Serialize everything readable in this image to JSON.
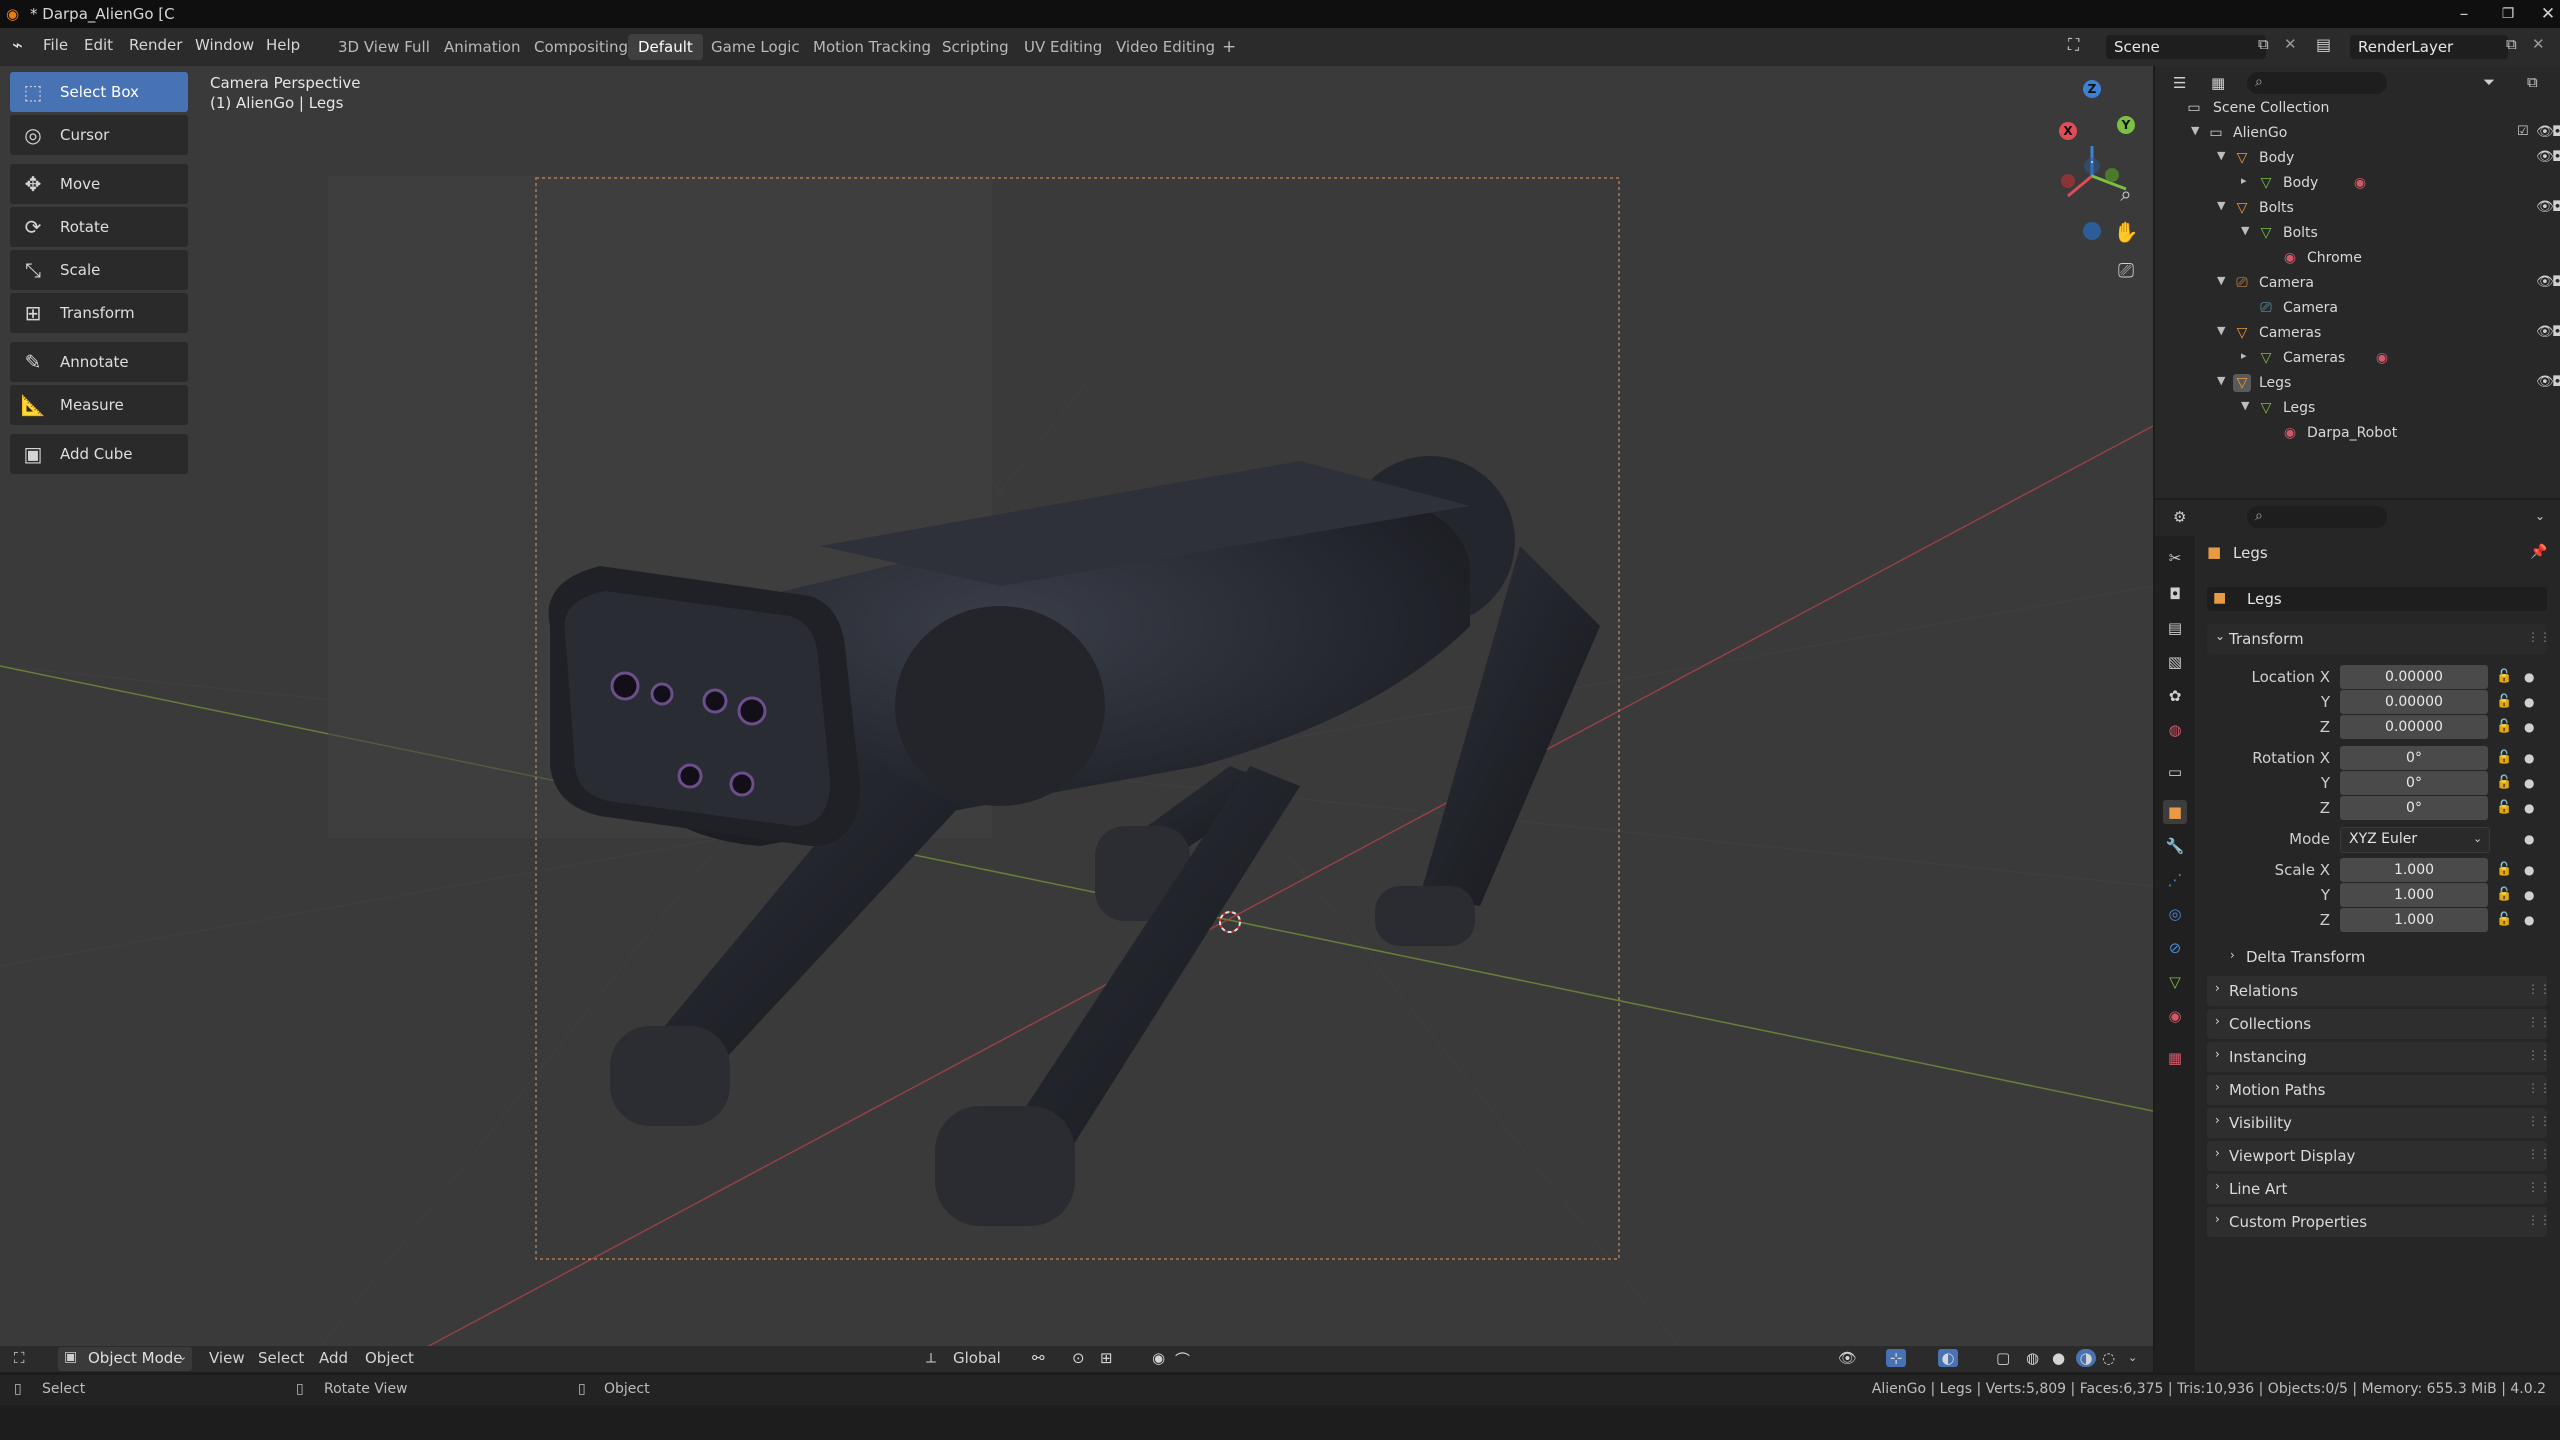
{
  "window": {
    "title": "* Darpa_AlienGo [C",
    "minimize": "–",
    "maximize": "❐",
    "close": "✕"
  },
  "menubar": {
    "menus": [
      "File",
      "Edit",
      "Render",
      "Window",
      "Help"
    ],
    "workspaces": [
      "3D View Full",
      "Animation",
      "Compositing",
      "Default",
      "Game Logic",
      "Motion Tracking",
      "Scripting",
      "UV Editing",
      "Video Editing"
    ],
    "active_workspace": "Default",
    "add_workspace": "+",
    "scene": "Scene",
    "render_layer": "RenderLayer"
  },
  "viewport": {
    "perspective": "Camera Perspective",
    "object_info": "(1) AlienGo | Legs",
    "tools": [
      "Select Box",
      "Cursor",
      "Move",
      "Rotate",
      "Scale",
      "Transform",
      "Annotate",
      "Measure",
      "Add Cube"
    ],
    "gizmo": {
      "x": "X",
      "y": "Y",
      "z": "Z"
    }
  },
  "viewport_header": {
    "mode": "Object Mode",
    "menus": [
      "View",
      "Select",
      "Add",
      "Object"
    ],
    "orientation": "Global"
  },
  "outliner": {
    "search_placeholder": "",
    "root": "Scene Collection",
    "items": [
      {
        "label": "AlienGo",
        "depth": 0
      },
      {
        "label": "Body",
        "depth": 1
      },
      {
        "label": "Body",
        "depth": 2
      },
      {
        "label": "Bolts",
        "depth": 1
      },
      {
        "label": "Bolts",
        "depth": 2
      },
      {
        "label": "Chrome",
        "depth": 3
      },
      {
        "label": "Camera",
        "depth": 1
      },
      {
        "label": "Camera",
        "depth": 2
      },
      {
        "label": "Cameras",
        "depth": 1
      },
      {
        "label": "Cameras",
        "depth": 2
      },
      {
        "label": "Legs",
        "depth": 1
      },
      {
        "label": "Legs",
        "depth": 2
      },
      {
        "label": "Darpa_Robot",
        "depth": 3
      }
    ]
  },
  "properties": {
    "object_name": "Legs",
    "datablock_name": "Legs",
    "transform_title": "Transform",
    "location_label": "Location X",
    "rotation_label": "Rotation X",
    "scale_label": "Scale X",
    "y_label": "Y",
    "z_label": "Z",
    "location": [
      "0.00000",
      "0.00000",
      "0.00000"
    ],
    "rotation": [
      "0°",
      "0°",
      "0°"
    ],
    "mode_label": "Mode",
    "mode_value": "XYZ Euler",
    "scale": [
      "1.000",
      "1.000",
      "1.000"
    ],
    "delta_transform": "Delta Transform",
    "sections": [
      "Relations",
      "Collections",
      "Instancing",
      "Motion Paths",
      "Visibility",
      "Viewport Display",
      "Line Art",
      "Custom Properties"
    ]
  },
  "statusbar": {
    "left": [
      "Select",
      "Rotate View",
      "Object"
    ],
    "stats": "AlienGo | Legs | Verts:5,809 | Faces:6,375 | Tris:10,936 | Objects:0/5 | Memory: 655.3 MiB | 4.0.2"
  },
  "colors": {
    "accent": "#4772b3",
    "x_axis": "#e04d56",
    "y_axis": "#7bc043",
    "z_axis": "#3b82d4"
  }
}
